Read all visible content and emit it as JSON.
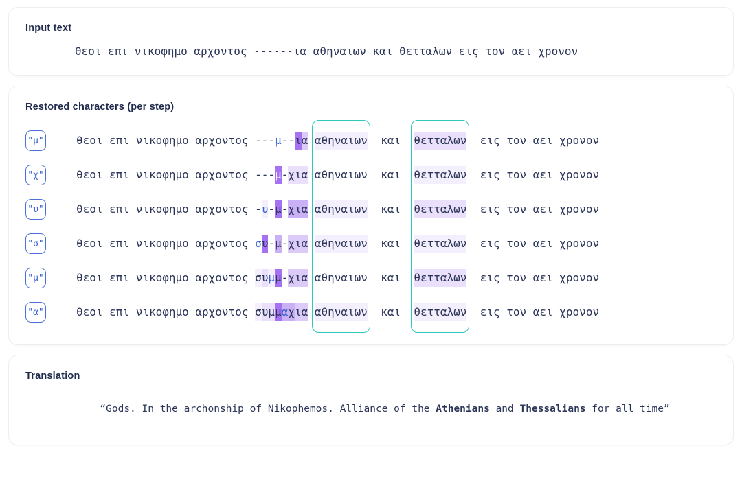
{
  "input_section": {
    "title": "Input text",
    "text": "θεοι επι νικοφημο αρχοντος ------ια αθηναιων και θετταλων εις τον αει χρονον"
  },
  "steps_section": {
    "title": "Restored characters (per step)",
    "prefix": "θεοι επι νικοφημο αρχοντος ",
    "suffix_mid": " αθηναιων και ",
    "suffix_end": " εις τον αει χρονον",
    "word_athenians": "αθηναιων",
    "word_kai": "και",
    "word_thessalians": "θετταλων",
    "tail": "εις τον αει χρονον",
    "steps": [
      {
        "badge": "\"μ\"",
        "restored_char": "μ",
        "gap": "---μ--ια"
      },
      {
        "badge": "\"χ\"",
        "restored_char": "χ",
        "gap": "---μ-χια"
      },
      {
        "badge": "\"υ\"",
        "restored_char": "υ",
        "gap": "-υ-μ-χια"
      },
      {
        "badge": "\"σ\"",
        "restored_char": "σ",
        "gap": "συ-μ-χια"
      },
      {
        "badge": "\"μ\"",
        "restored_char": "μ",
        "gap": "συμμ-χια"
      },
      {
        "badge": "\"α\"",
        "restored_char": "α",
        "gap": "συμμαχια"
      }
    ],
    "highlight_boxes": [
      {
        "label": "αθηναιων"
      },
      {
        "label": "θετταλων"
      }
    ]
  },
  "translation_section": {
    "title": "Translation",
    "open_quote": "“",
    "part1": "Gods. In the archonship of Nikophemos. Alliance of the ",
    "bold1": "Athenians",
    "part2": " and ",
    "bold2": "Thessalians",
    "part3": " for all time",
    "close_quote": "”"
  },
  "colors": {
    "accent_purple": "#7a2fe6",
    "new_char_blue": "#3a63d0",
    "teal_box": "#2ec7bd",
    "text": "#2b3558",
    "title": "#1f2a4d"
  }
}
